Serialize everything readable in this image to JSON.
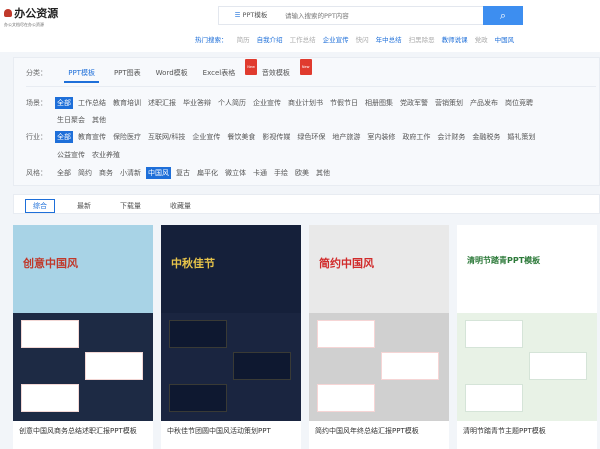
{
  "header": {
    "logo_title": "办公资源",
    "logo_subtitle": "办公文档尽在办公资源",
    "search_category": "PPT模板",
    "search_placeholder": "请输入搜索的PPT内容",
    "hot_label": "热门搜索：",
    "hot_items": [
      {
        "t": "简历",
        "c": "g"
      },
      {
        "t": "自我介绍",
        "c": "b"
      },
      {
        "t": "工作总结",
        "c": "g"
      },
      {
        "t": "企业宣传",
        "c": "b"
      },
      {
        "t": "快闪",
        "c": "g"
      },
      {
        "t": "年中总结",
        "c": "b"
      },
      {
        "t": "扫黑除恶",
        "c": "g"
      },
      {
        "t": "教师说课",
        "c": "b"
      },
      {
        "t": "党政",
        "c": "g"
      },
      {
        "t": "中国风",
        "c": "b"
      }
    ]
  },
  "filters": {
    "category_label": "分类：",
    "categories": [
      "PPT模板",
      "PPT图表",
      "Word模板",
      "Excel表格",
      "音效模板"
    ],
    "new_badge": "New",
    "scene_label": "场景：",
    "scenes": [
      "全部",
      "工作总结",
      "教育培训",
      "述职汇报",
      "毕业答辩",
      "个人简历",
      "企业宣传",
      "商业计划书",
      "节假节日",
      "相册图集",
      "党政军警",
      "营销策划",
      "产品发布",
      "岗位竞聘"
    ],
    "scenes2": [
      "生日聚会",
      "其他"
    ],
    "industry_label": "行业：",
    "industries": [
      "全部",
      "教育宣传",
      "保险医疗",
      "互联网/科技",
      "企业宣传",
      "餐饮美食",
      "影视传媒",
      "绿色环保",
      "地产旅游",
      "室内装修",
      "政府工作",
      "会计财务",
      "金融税务",
      "婚礼策划"
    ],
    "industries2": [
      "公益宣传",
      "农业养殖"
    ],
    "style_label": "风格：",
    "styles": [
      "全部",
      "简约",
      "商务",
      "小清新",
      "中国风",
      "复古",
      "扁平化",
      "微立体",
      "卡通",
      "手绘",
      "欧美",
      "其他"
    ]
  },
  "sort": [
    "综合",
    "最新",
    "下载量",
    "收藏量"
  ],
  "cards": [
    {
      "title": "创意中国风商务总结述职汇报PPT模板",
      "cover": "创意中国风"
    },
    {
      "title": "中秋佳节团圆中国风活动策划PPT",
      "cover": "中秋佳节"
    },
    {
      "title": "简约中国风年终总结汇报PPT模板",
      "cover": "简约中国风"
    },
    {
      "title": "清明节踏青节主题PPT模板",
      "cover": "清明节踏青PPT模板"
    }
  ]
}
